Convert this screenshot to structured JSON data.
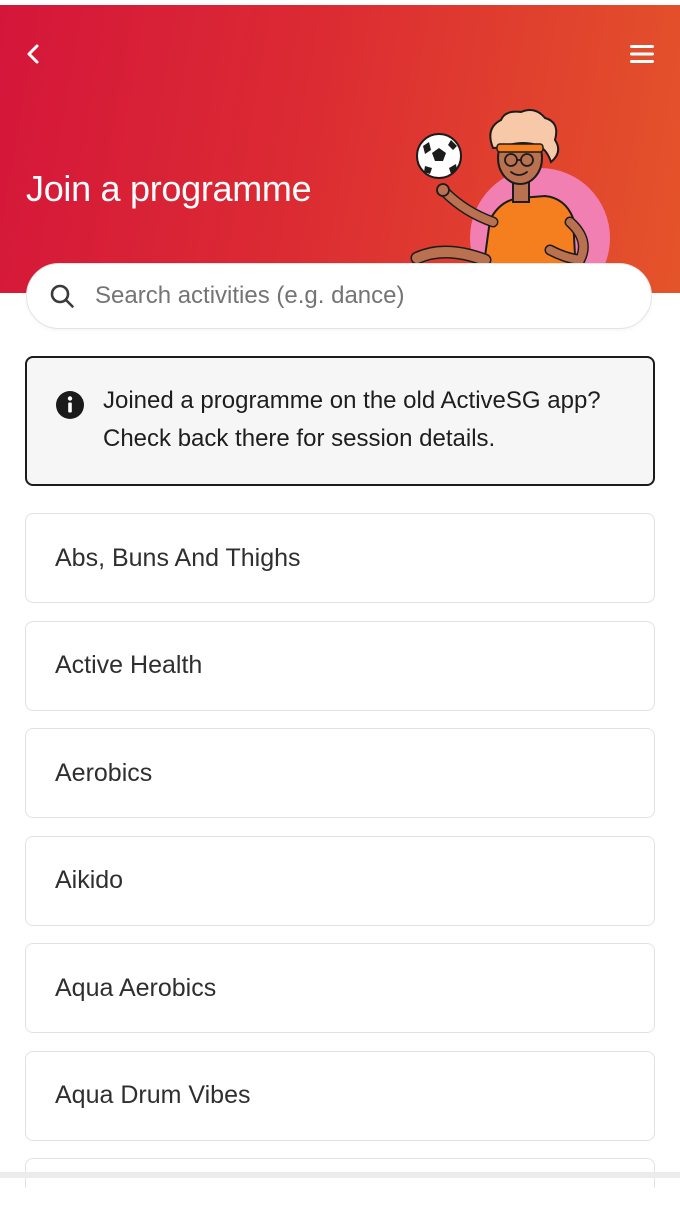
{
  "header": {
    "title": "Join a programme",
    "back_icon": "chevron-left-icon",
    "menu_icon": "hamburger-menu-icon",
    "gradient_start": "#d4163a",
    "gradient_end": "#e4542a"
  },
  "search": {
    "placeholder": "Search activities (e.g. dance)",
    "value": "",
    "icon": "search-icon"
  },
  "notice": {
    "icon": "info-icon",
    "text": "Joined a programme on the old ActiveSG app? Check back there for session details."
  },
  "activities": [
    {
      "label": "Abs, Buns And Thighs"
    },
    {
      "label": "Active Health"
    },
    {
      "label": "Aerobics"
    },
    {
      "label": "Aikido"
    },
    {
      "label": "Aqua Aerobics"
    },
    {
      "label": "Aqua Drum Vibes"
    }
  ]
}
